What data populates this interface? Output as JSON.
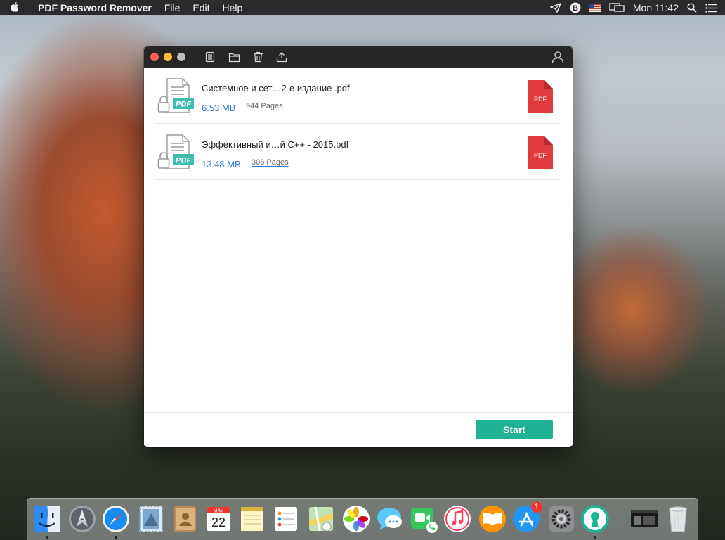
{
  "menubar": {
    "app_name": "PDF Password Remover",
    "menus": [
      "File",
      "Edit",
      "Help"
    ],
    "clock": "Mon 11:42"
  },
  "files": [
    {
      "name": "Системное и сет…2-е издание .pdf",
      "size": "6.53 MB",
      "pages": "944 Pages",
      "thumb_label": "PDF",
      "badge_label": "PDF"
    },
    {
      "name": "Эффективный и…й C++ - 2015.pdf",
      "size": "13.48 MB",
      "pages": "306 Pages",
      "thumb_label": "PDF",
      "badge_label": "PDF"
    }
  ],
  "footer": {
    "start_label": "Start"
  },
  "dock": {
    "calendar_month": "MAY",
    "calendar_day": "22",
    "appstore_badge": "1"
  },
  "colors": {
    "accent": "#1fb394",
    "size_blue": "#2b7bd6",
    "pdf_red": "#e0393e",
    "thumb_teal": "#3dbdb0"
  }
}
